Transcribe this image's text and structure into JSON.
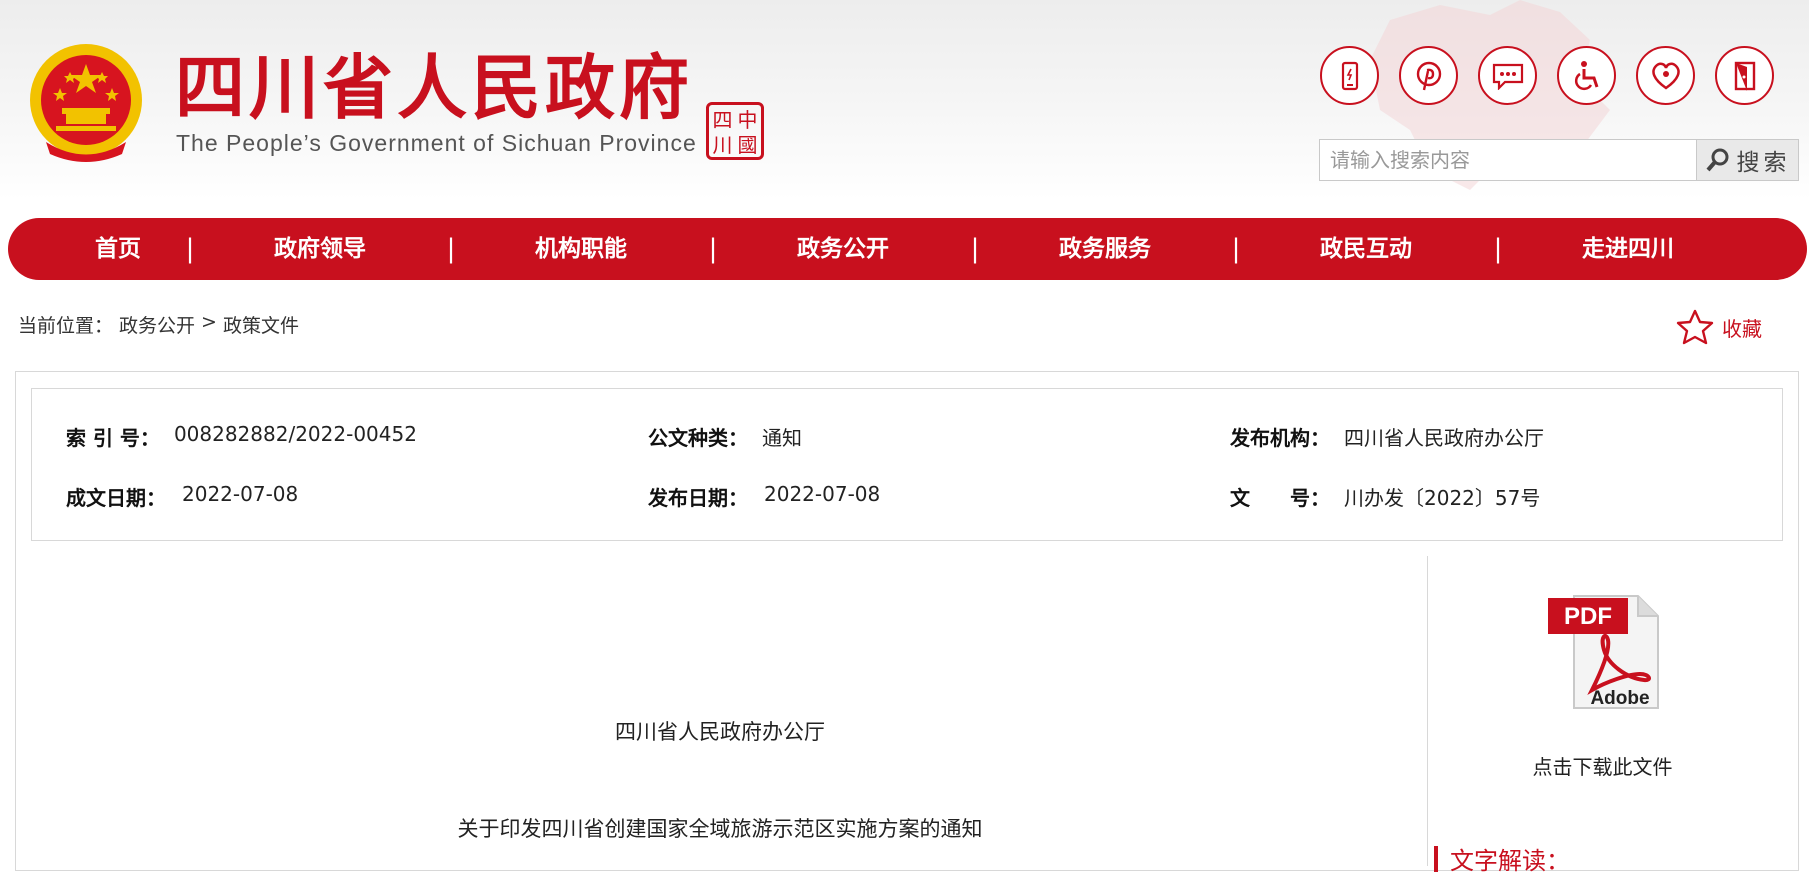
{
  "header": {
    "title": "四川省人民政府",
    "subtitle": "The People’s Government of Sichuan Province",
    "seal_chars": [
      "中",
      "四",
      "國",
      "川"
    ],
    "icons": [
      "mobile-icon",
      "pinterest-icon",
      "message-icon",
      "accessibility-icon",
      "elderly-care-icon",
      "exit-door-icon"
    ],
    "search": {
      "placeholder": "请输入搜索内容",
      "button_label": "搜索"
    }
  },
  "nav": {
    "items": [
      "首页",
      "政府领导",
      "机构职能",
      "政务公开",
      "政务服务",
      "政民互动",
      "走进四川"
    ],
    "separator": "|"
  },
  "breadcrumb": {
    "prefix": "当前位置：",
    "items": [
      "政务公开",
      "政策文件"
    ],
    "separator": ">"
  },
  "favorite": {
    "label": "收藏"
  },
  "meta": {
    "index_no": {
      "label": "索 引 号：",
      "value": "008282882/2022-00452"
    },
    "doc_type": {
      "label": "公文种类：",
      "value": "通知"
    },
    "publisher": {
      "label": "发布机构：",
      "value": "四川省人民政府办公厅"
    },
    "written_date": {
      "label": "成文日期：",
      "value": "2022-07-08"
    },
    "publish_date": {
      "label": "发布日期：",
      "value": "2022-07-08"
    },
    "doc_no": {
      "label": "文　　号：",
      "value": "川办发〔2022〕57号"
    }
  },
  "document": {
    "issuer": "四川省人民政府办公厅",
    "title": "关于印发四川省创建国家全域旅游示范区实施方案的通知"
  },
  "sidebar": {
    "pdf_badge": "PDF",
    "pdf_brand": "Adobe",
    "download_label": "点击下载此文件",
    "section_title": "文字解读："
  },
  "colors": {
    "brand_red": "#c8101e",
    "emblem_gold": "#f2c200"
  }
}
